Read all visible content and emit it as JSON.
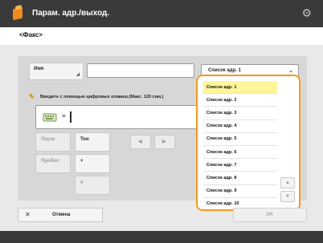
{
  "window": {
    "title": "Парам. адр./выход.",
    "subtitle": "<Факс>"
  },
  "icons": {
    "app": "document-app-icon",
    "settings": "gear-icon",
    "hint": "pencil-icon",
    "keyboard": "keyboard-icon"
  },
  "form": {
    "name_button_label": "Имя",
    "name_value": "",
    "selected_list": "Список адр. 1",
    "hint": "Введите с помощью цифровых клавиш.(Макс. 120 сим.)",
    "input_value": "",
    "input_marker": "≡"
  },
  "keys": {
    "space": "Пауза",
    "type": "Тон",
    "backspace": "Пробел",
    "plus": "+",
    "number": "#",
    "left": "◀",
    "right": "▶"
  },
  "address_lists": [
    "Список адр. 1",
    "Список адр. 2",
    "Список адр. 3",
    "Список адр. 4",
    "Список адр. 5",
    "Список адр. 6",
    "Список адр. 7",
    "Список адр. 8",
    "Список адр. 9",
    "Список адр. 10"
  ],
  "selected_index": 0,
  "footer": {
    "cancel": "Отмена",
    "ok": "OK"
  },
  "colors": {
    "accent": "#f29a1f",
    "selection": "#fff59a"
  }
}
